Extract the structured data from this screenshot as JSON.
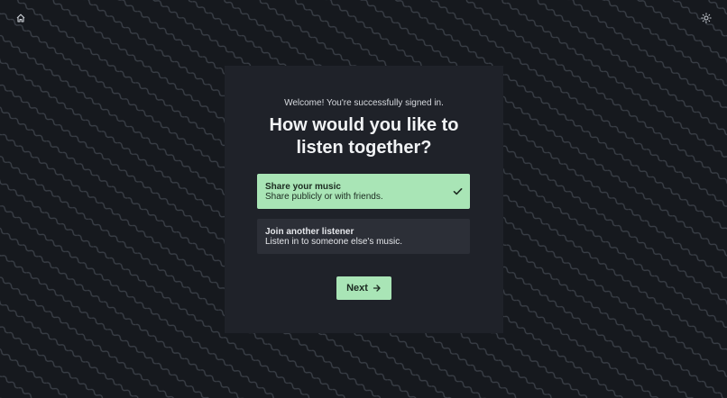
{
  "header": {
    "home_icon": "home-icon",
    "theme_icon": "sun-icon"
  },
  "card": {
    "welcome_text": "Welcome! You're successfully signed in.",
    "heading_line1": "How would you like to",
    "heading_line2": "listen together?",
    "options": [
      {
        "title": "Share your music",
        "description": "Share publicly or with friends.",
        "selected": true,
        "icon": "check-icon"
      },
      {
        "title": "Join another listener",
        "description": "Listen in to someone else's music.",
        "selected": false
      }
    ],
    "next_label": "Next",
    "next_icon": "arrow-right-icon"
  },
  "colors": {
    "background": "#16191e",
    "card": "#1f2229",
    "accent": "#a9e5b6",
    "option_unselected": "#2c2f37"
  }
}
